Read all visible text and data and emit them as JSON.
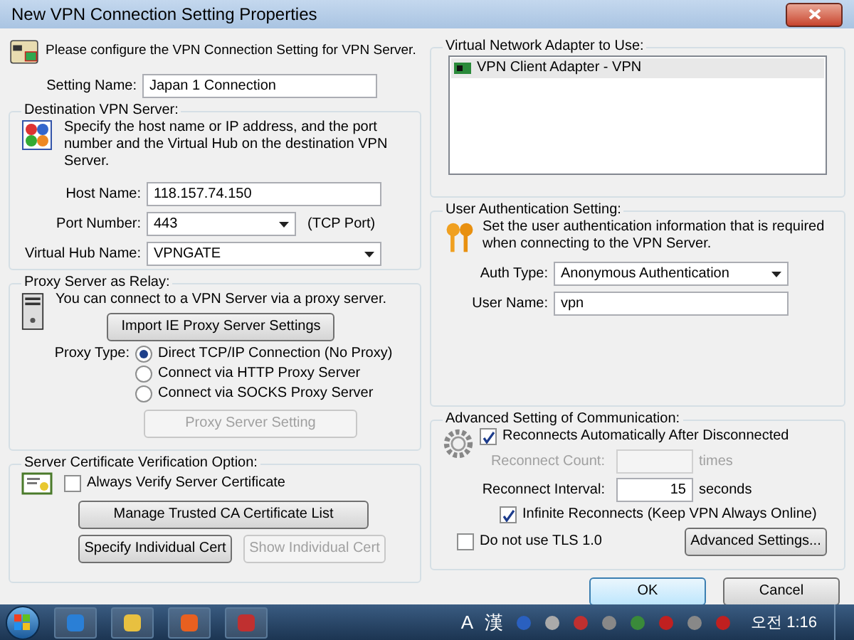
{
  "window": {
    "title": "New VPN Connection Setting Properties"
  },
  "intro": "Please configure the VPN Connection Setting for VPN Server.",
  "setting_name": {
    "label": "Setting Name:",
    "value": "Japan 1 Connection"
  },
  "destination": {
    "title": "Destination VPN Server:",
    "description": "Specify the host name or IP address, and the port number and the Virtual Hub on the destination VPN Server.",
    "host": {
      "label": "Host Name:",
      "value": "118.157.74.150"
    },
    "port": {
      "label": "Port Number:",
      "value": "443",
      "note": "(TCP Port)"
    },
    "hub": {
      "label": "Virtual Hub Name:",
      "value": "VPNGATE"
    }
  },
  "proxy": {
    "title": "Proxy Server as Relay:",
    "description": "You can connect to a VPN Server via a proxy server.",
    "import_button": "Import IE Proxy Server Settings",
    "type_label": "Proxy Type:",
    "options": [
      {
        "label": "Direct TCP/IP Connection (No Proxy)",
        "selected": true
      },
      {
        "label": "Connect via HTTP Proxy Server",
        "selected": false
      },
      {
        "label": "Connect via SOCKS Proxy Server",
        "selected": false
      }
    ],
    "setting_button": {
      "label": "Proxy Server Setting",
      "disabled": true
    }
  },
  "certificate": {
    "title": "Server Certificate Verification Option:",
    "verify": {
      "label": "Always Verify Server Certificate",
      "checked": false
    },
    "manage_button": {
      "label": "Manage Trusted CA Certificate List",
      "disabled": false
    },
    "specify_button": {
      "label": "Specify Individual Cert",
      "disabled": false
    },
    "show_button": {
      "label": "Show Individual Cert",
      "disabled": true
    }
  },
  "adapter": {
    "title": "Virtual Network Adapter to Use:",
    "items": [
      {
        "label": "VPN Client Adapter - VPN",
        "selected": true
      }
    ]
  },
  "auth": {
    "title": "User Authentication Setting:",
    "description": "Set the user authentication information that is required when connecting to the VPN Server.",
    "auth_type": {
      "label": "Auth Type:",
      "value": "Anonymous Authentication"
    },
    "user_name": {
      "label": "User Name:",
      "value": "vpn"
    }
  },
  "advanced": {
    "title": "Advanced Setting of Communication:",
    "reconnect": {
      "label": "Reconnects Automatically After Disconnected",
      "checked": true
    },
    "count": {
      "label": "Reconnect Count:",
      "unit": "times",
      "disabled": true
    },
    "interval": {
      "label": "Reconnect Interval:",
      "value": "15",
      "unit": "seconds",
      "disabled": false
    },
    "infinite": {
      "label": "Infinite Reconnects (Keep VPN Always Online)",
      "checked": true
    },
    "no_tls": {
      "label": "Do not use TLS 1.0",
      "checked": false
    },
    "advanced_button": "Advanced Settings..."
  },
  "buttons": [
    {
      "label": "OK",
      "selected": true
    },
    {
      "label": "Cancel",
      "selected": false
    }
  ],
  "taskbar": {
    "tray_text": [
      "A",
      "漢"
    ],
    "clock": "오전 1:16"
  }
}
